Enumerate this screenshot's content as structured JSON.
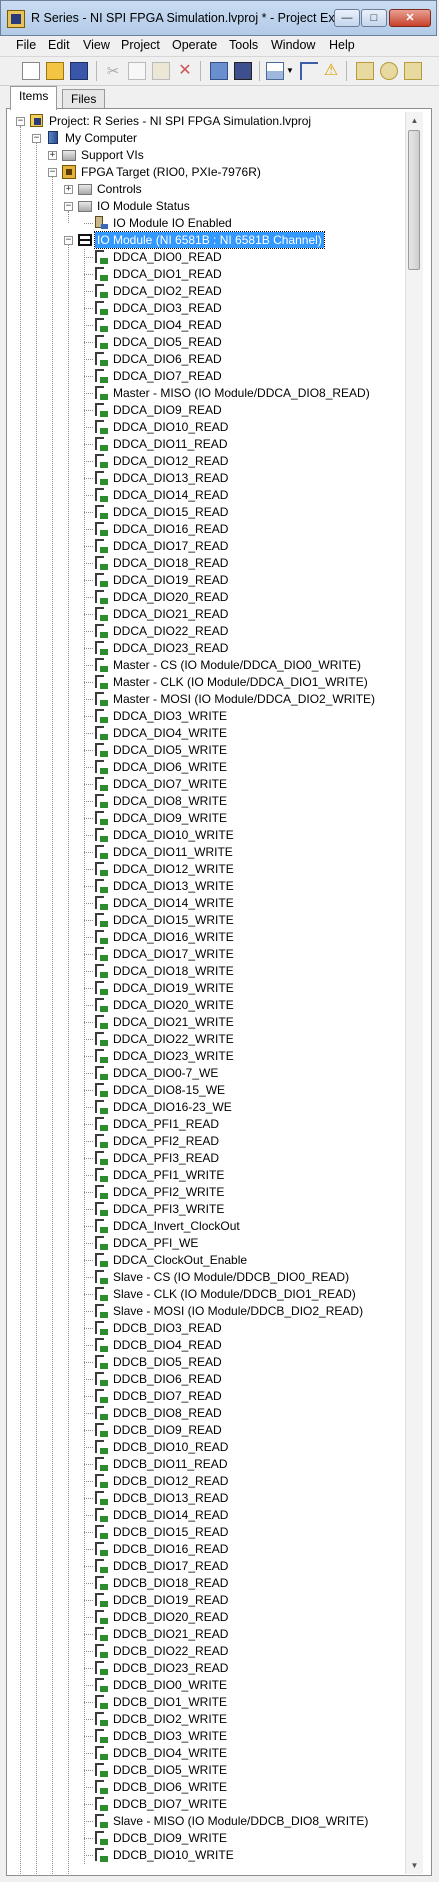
{
  "window": {
    "title": "R Series - NI SPI FPGA Simulation.lvproj * - Project Expl...",
    "min_label": "—",
    "max_label": "□",
    "close_label": "✕"
  },
  "menu": [
    "File",
    "Edit",
    "View",
    "Project",
    "Operate",
    "Tools",
    "Window",
    "Help"
  ],
  "toolbar_icons": [
    "new-icon",
    "open-icon",
    "save-all-icon",
    "cut-icon",
    "copy-icon",
    "paste-icon",
    "delete-icon",
    "build-icon",
    "deploy-icon",
    "view-options-icon",
    "dropdown-icon",
    "hierarchy-icon",
    "warning-icon",
    "filter-icon",
    "refresh-icon",
    "help-icon"
  ],
  "tabs": [
    {
      "label": "Items",
      "active": true
    },
    {
      "label": "Files",
      "active": false
    }
  ],
  "tree": {
    "header": [
      {
        "label": "Project: R Series - NI SPI FPGA Simulation.lvproj",
        "icon": "project-icon",
        "level": 0,
        "expander": "-"
      },
      {
        "label": "My Computer",
        "icon": "computer-icon",
        "level": 1,
        "expander": "-"
      },
      {
        "label": "Support VIs",
        "icon": "folder-icon",
        "level": 2,
        "expander": "+"
      },
      {
        "label": "FPGA Target (RIO0, PXIe-7976R)",
        "icon": "fpga-icon",
        "level": 2,
        "expander": "-"
      },
      {
        "label": "Controls",
        "icon": "folder-icon",
        "level": 3,
        "expander": "+"
      },
      {
        "label": "IO Module Status",
        "icon": "folder-icon",
        "level": 3,
        "expander": "-"
      },
      {
        "label": "IO Module IO Enabled",
        "icon": "io-item-icon",
        "level": 4,
        "expander": ""
      },
      {
        "label": "IO Module (NI 6581B : NI 6581B Channel)",
        "icon": "module-icon",
        "level": 3,
        "expander": "-",
        "selected": true
      }
    ],
    "channels": [
      "DDCA_DIO0_READ",
      "DDCA_DIO1_READ",
      "DDCA_DIO2_READ",
      "DDCA_DIO3_READ",
      "DDCA_DIO4_READ",
      "DDCA_DIO5_READ",
      "DDCA_DIO6_READ",
      "DDCA_DIO7_READ",
      "Master - MISO (IO Module/DDCA_DIO8_READ)",
      "DDCA_DIO9_READ",
      "DDCA_DIO10_READ",
      "DDCA_DIO11_READ",
      "DDCA_DIO12_READ",
      "DDCA_DIO13_READ",
      "DDCA_DIO14_READ",
      "DDCA_DIO15_READ",
      "DDCA_DIO16_READ",
      "DDCA_DIO17_READ",
      "DDCA_DIO18_READ",
      "DDCA_DIO19_READ",
      "DDCA_DIO20_READ",
      "DDCA_DIO21_READ",
      "DDCA_DIO22_READ",
      "DDCA_DIO23_READ",
      "Master - CS (IO Module/DDCA_DIO0_WRITE)",
      "Master - CLK (IO Module/DDCA_DIO1_WRITE)",
      "Master - MOSI (IO Module/DDCA_DIO2_WRITE)",
      "DDCA_DIO3_WRITE",
      "DDCA_DIO4_WRITE",
      "DDCA_DIO5_WRITE",
      "DDCA_DIO6_WRITE",
      "DDCA_DIO7_WRITE",
      "DDCA_DIO8_WRITE",
      "DDCA_DIO9_WRITE",
      "DDCA_DIO10_WRITE",
      "DDCA_DIO11_WRITE",
      "DDCA_DIO12_WRITE",
      "DDCA_DIO13_WRITE",
      "DDCA_DIO14_WRITE",
      "DDCA_DIO15_WRITE",
      "DDCA_DIO16_WRITE",
      "DDCA_DIO17_WRITE",
      "DDCA_DIO18_WRITE",
      "DDCA_DIO19_WRITE",
      "DDCA_DIO20_WRITE",
      "DDCA_DIO21_WRITE",
      "DDCA_DIO22_WRITE",
      "DDCA_DIO23_WRITE",
      "DDCA_DIO0-7_WE",
      "DDCA_DIO8-15_WE",
      "DDCA_DIO16-23_WE",
      "DDCA_PFI1_READ",
      "DDCA_PFI2_READ",
      "DDCA_PFI3_READ",
      "DDCA_PFI1_WRITE",
      "DDCA_PFI2_WRITE",
      "DDCA_PFI3_WRITE",
      "DDCA_Invert_ClockOut",
      "DDCA_PFI_WE",
      "DDCA_ClockOut_Enable",
      "Slave - CS (IO Module/DDCB_DIO0_READ)",
      "Slave - CLK (IO Module/DDCB_DIO1_READ)",
      "Slave - MOSI (IO Module/DDCB_DIO2_READ)",
      "DDCB_DIO3_READ",
      "DDCB_DIO4_READ",
      "DDCB_DIO5_READ",
      "DDCB_DIO6_READ",
      "DDCB_DIO7_READ",
      "DDCB_DIO8_READ",
      "DDCB_DIO9_READ",
      "DDCB_DIO10_READ",
      "DDCB_DIO11_READ",
      "DDCB_DIO12_READ",
      "DDCB_DIO13_READ",
      "DDCB_DIO14_READ",
      "DDCB_DIO15_READ",
      "DDCB_DIO16_READ",
      "DDCB_DIO17_READ",
      "DDCB_DIO18_READ",
      "DDCB_DIO19_READ",
      "DDCB_DIO20_READ",
      "DDCB_DIO21_READ",
      "DDCB_DIO22_READ",
      "DDCB_DIO23_READ",
      "DDCB_DIO0_WRITE",
      "DDCB_DIO1_WRITE",
      "DDCB_DIO2_WRITE",
      "DDCB_DIO3_WRITE",
      "DDCB_DIO4_WRITE",
      "DDCB_DIO5_WRITE",
      "DDCB_DIO6_WRITE",
      "DDCB_DIO7_WRITE",
      "Slave - MISO (IO Module/DDCB_DIO8_WRITE)",
      "DDCB_DIO9_WRITE",
      "DDCB_DIO10_WRITE"
    ]
  },
  "scrollbar": {
    "up": "▲",
    "down": "▼"
  },
  "colors": {
    "selection": "#3399ff",
    "titlebar": "#c9dcf2",
    "channel_icon": "#2e8b2e"
  }
}
